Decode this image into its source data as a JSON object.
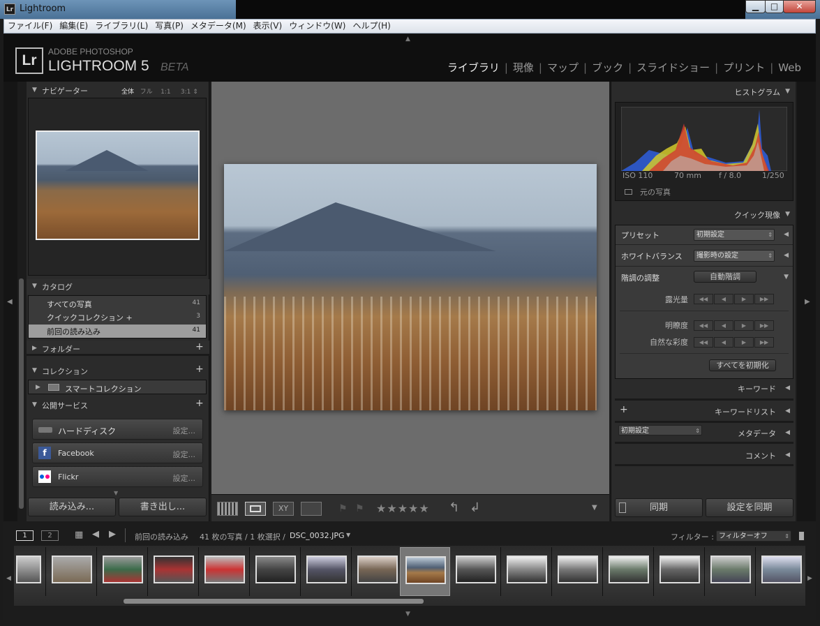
{
  "window": {
    "title": "Lightroom",
    "app_icon": "Lr",
    "min": "▁",
    "max": "□",
    "close": "✕"
  },
  "menu": [
    "ファイル(F)",
    "編集(E)",
    "ライブラリ(L)",
    "写真(P)",
    "メタデータ(M)",
    "表示(V)",
    "ウィンドウ(W)",
    "ヘルプ(H)"
  ],
  "brand": {
    "logo": "Lr",
    "line1": "ADOBE PHOTOSHOP",
    "line2": "LIGHTROOM 5",
    "line3": "BETA"
  },
  "modules": [
    "ライブラリ",
    "現像",
    "マップ",
    "ブック",
    "スライドショー",
    "プリント",
    "Web"
  ],
  "navigator": {
    "title": "ナビゲーター",
    "opts": [
      "全体",
      "フル",
      "1:1",
      "3:1"
    ]
  },
  "catalog": {
    "title": "カタログ",
    "items": [
      {
        "label": "すべての写真",
        "count": "41"
      },
      {
        "label": "クイックコレクション  +",
        "count": "3"
      },
      {
        "label": "前回の読み込み",
        "count": "41"
      }
    ]
  },
  "folders": {
    "title": "フォルダー"
  },
  "collections": {
    "title": "コレクション",
    "smart": "スマートコレクション"
  },
  "publish": {
    "title": "公開サービス",
    "items": [
      {
        "name": "ハードディスク",
        "setup": "設定..."
      },
      {
        "name": "Facebook",
        "setup": "設定..."
      },
      {
        "name": "Flickr",
        "setup": "設定..."
      }
    ]
  },
  "left_buttons": {
    "import": "読み込み...",
    "export": "書き出し..."
  },
  "histogram": {
    "title": "ヒストグラム",
    "iso": "ISO 110",
    "focal": "70 mm",
    "aperture": "f / 8.0",
    "shutter": "1/250",
    "original": "元の写真"
  },
  "quick_develop": {
    "title": "クイック現像",
    "preset_label": "プリセット",
    "preset_value": "初期設定",
    "wb_label": "ホワイトバランス",
    "wb_value": "撮影時の設定",
    "tone_label": "階調の調整",
    "auto_tone": "自動階調",
    "exposure": "露光量",
    "clarity": "明瞭度",
    "vibrance": "自然な彩度",
    "reset_all": "すべてを初期化"
  },
  "right_sections": {
    "keywords": "キーワード",
    "keyword_list": "キーワードリスト",
    "metadata_preset": "初期設定",
    "metadata": "メタデータ",
    "comments": "コメント"
  },
  "right_buttons": {
    "sync": "同期",
    "sync_settings": "設定を同期"
  },
  "filmstrip": {
    "page1": "1",
    "page2": "2",
    "source": "前回の読み込み",
    "info": "41 枚の写真 / 1 枚選択 /",
    "file": "DSC_0032.JPG",
    "filter_label": "フィルター :",
    "filter_value": "フィルターオフ"
  },
  "toolbar": {
    "stars": "★★★★★"
  },
  "colors": {
    "accent_selected": "#555555",
    "panel_bg": "#2b2b2b",
    "center_bg": "#6c6c6c"
  }
}
